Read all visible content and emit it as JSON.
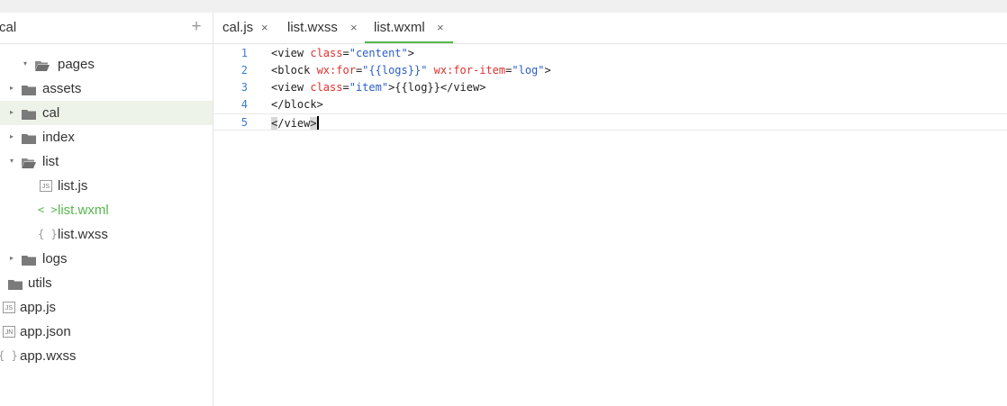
{
  "sidebar": {
    "title": "cal",
    "add_label": "+",
    "tree": [
      {
        "label": "pages",
        "kind": "folder-open"
      },
      {
        "label": "assets",
        "kind": "folder"
      },
      {
        "label": "cal",
        "kind": "folder",
        "selected": true
      },
      {
        "label": "index",
        "kind": "folder"
      },
      {
        "label": "list",
        "kind": "folder-open"
      },
      {
        "label": "list.js",
        "kind": "js",
        "badge": "JS"
      },
      {
        "label": "list.wxml",
        "kind": "wxml",
        "glyph": "< >",
        "active": true
      },
      {
        "label": "list.wxss",
        "kind": "wxss",
        "glyph": "{ }"
      },
      {
        "label": "logs",
        "kind": "folder"
      },
      {
        "label": "utils",
        "kind": "folder"
      },
      {
        "label": "app.js",
        "kind": "js",
        "badge": "JS"
      },
      {
        "label": "app.json",
        "kind": "json",
        "badge": "JN"
      },
      {
        "label": "app.wxss",
        "kind": "wxss",
        "glyph": "{ }"
      }
    ]
  },
  "tabs": [
    {
      "label": "cal.js",
      "close": "×"
    },
    {
      "label": "list.wxss",
      "close": "×"
    },
    {
      "label": "list.wxml",
      "close": "×",
      "active": true
    }
  ],
  "editor": {
    "lines": [
      {
        "num": "1",
        "tokens": [
          [
            "tag",
            "<view "
          ],
          [
            "attr",
            "class"
          ],
          [
            "tag",
            "="
          ],
          [
            "str",
            "\"centent\""
          ],
          [
            "tag",
            ">"
          ]
        ]
      },
      {
        "num": "2",
        "tokens": [
          [
            "tag",
            "<block "
          ],
          [
            "attr",
            "wx:for"
          ],
          [
            "tag",
            "="
          ],
          [
            "str",
            "\"{{logs}}\""
          ],
          [
            "tag",
            " "
          ],
          [
            "attr",
            "wx:for-item"
          ],
          [
            "tag",
            "="
          ],
          [
            "str",
            "\"log\""
          ],
          [
            "tag",
            ">"
          ]
        ]
      },
      {
        "num": "3",
        "tokens": [
          [
            "tag",
            "<view "
          ],
          [
            "attr",
            "class"
          ],
          [
            "tag",
            "="
          ],
          [
            "str",
            "\"item\""
          ],
          [
            "tag",
            ">{{log}}</view>"
          ]
        ]
      },
      {
        "num": "4",
        "tokens": [
          [
            "tag",
            "</block>"
          ]
        ]
      },
      {
        "num": "5",
        "tokens": [
          [
            "hl",
            "<"
          ],
          [
            "tag",
            "/view"
          ],
          [
            "hl",
            ">"
          ]
        ],
        "current": true
      }
    ]
  },
  "colors": {
    "accent": "#54b94c",
    "line_number": "#3a7bd5",
    "attribute": "#e0312f",
    "string": "#2a5ec7"
  }
}
